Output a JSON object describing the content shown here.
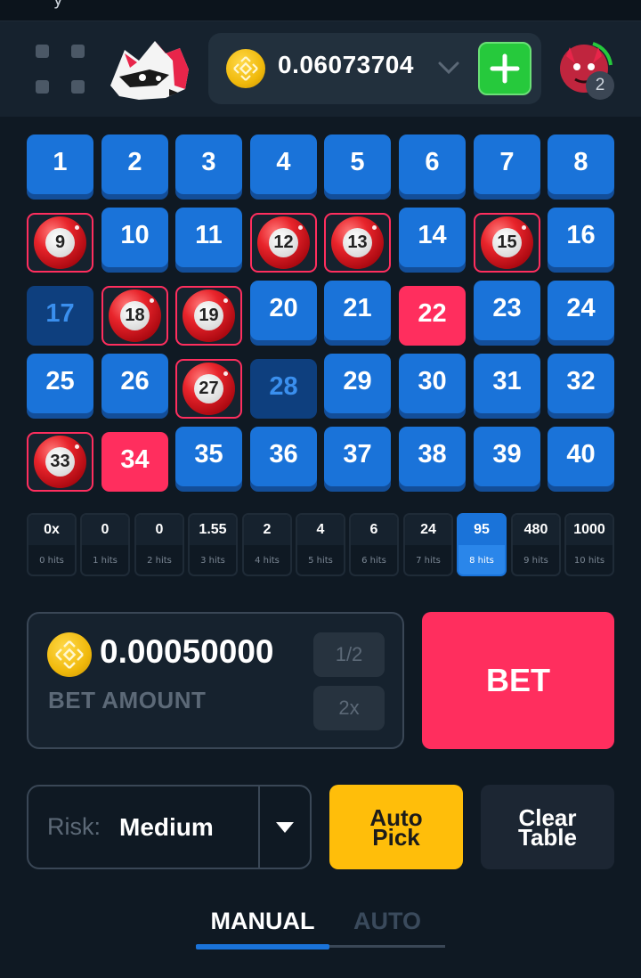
{
  "header": {
    "balance": "0.06073704",
    "notifications_count": "2"
  },
  "tiles": [
    {
      "n": "1",
      "state": "blue"
    },
    {
      "n": "2",
      "state": "blue"
    },
    {
      "n": "3",
      "state": "blue"
    },
    {
      "n": "4",
      "state": "blue"
    },
    {
      "n": "5",
      "state": "blue"
    },
    {
      "n": "6",
      "state": "blue"
    },
    {
      "n": "7",
      "state": "blue"
    },
    {
      "n": "8",
      "state": "blue"
    },
    {
      "n": "9",
      "state": "hit"
    },
    {
      "n": "10",
      "state": "blue"
    },
    {
      "n": "11",
      "state": "blue"
    },
    {
      "n": "12",
      "state": "hit"
    },
    {
      "n": "13",
      "state": "hit"
    },
    {
      "n": "14",
      "state": "blue"
    },
    {
      "n": "15",
      "state": "hit"
    },
    {
      "n": "16",
      "state": "blue"
    },
    {
      "n": "17",
      "state": "dim"
    },
    {
      "n": "18",
      "state": "hit"
    },
    {
      "n": "19",
      "state": "hit"
    },
    {
      "n": "20",
      "state": "blue"
    },
    {
      "n": "21",
      "state": "blue"
    },
    {
      "n": "22",
      "state": "red"
    },
    {
      "n": "23",
      "state": "blue"
    },
    {
      "n": "24",
      "state": "blue"
    },
    {
      "n": "25",
      "state": "blue"
    },
    {
      "n": "26",
      "state": "blue"
    },
    {
      "n": "27",
      "state": "hit"
    },
    {
      "n": "28",
      "state": "dim"
    },
    {
      "n": "29",
      "state": "blue"
    },
    {
      "n": "30",
      "state": "blue"
    },
    {
      "n": "31",
      "state": "blue"
    },
    {
      "n": "32",
      "state": "blue"
    },
    {
      "n": "33",
      "state": "hit"
    },
    {
      "n": "34",
      "state": "red"
    },
    {
      "n": "35",
      "state": "blue"
    },
    {
      "n": "36",
      "state": "blue"
    },
    {
      "n": "37",
      "state": "blue"
    },
    {
      "n": "38",
      "state": "blue"
    },
    {
      "n": "39",
      "state": "blue"
    },
    {
      "n": "40",
      "state": "blue"
    }
  ],
  "payouts": [
    {
      "multiplier": "0x",
      "hits": "0 hits"
    },
    {
      "multiplier": "0",
      "hits": "1 hits"
    },
    {
      "multiplier": "0",
      "hits": "2 hits"
    },
    {
      "multiplier": "1.55",
      "hits": "3 hits"
    },
    {
      "multiplier": "2",
      "hits": "4 hits"
    },
    {
      "multiplier": "4",
      "hits": "5 hits"
    },
    {
      "multiplier": "6",
      "hits": "6 hits"
    },
    {
      "multiplier": "24",
      "hits": "7 hits"
    },
    {
      "multiplier": "95",
      "hits": "8 hits",
      "active": true
    },
    {
      "multiplier": "480",
      "hits": "9 hits"
    },
    {
      "multiplier": "1000",
      "hits": "10 hits"
    }
  ],
  "bet": {
    "amount": "0.00050000",
    "label": "BET AMOUNT",
    "half_label": "1/2",
    "double_label": "2x",
    "button_label": "BET"
  },
  "risk": {
    "label": "Risk:",
    "value": "Medium"
  },
  "actions": {
    "auto_pick_line1": "Auto",
    "auto_pick_line2": "Pick",
    "clear_table_line1": "Clear",
    "clear_table_line2": "Table"
  },
  "tabs": {
    "manual": "MANUAL",
    "auto": "AUTO"
  },
  "colors": {
    "background": "#0f1923",
    "tile_blue": "#1a73d9",
    "accent_red": "#ff2e5e",
    "accent_green": "#26c93c",
    "accent_yellow": "#ffbe0a",
    "coin_gold": "#f0b90b"
  },
  "icons": {
    "menu": "menu-grid-icon",
    "logo": "raccoon-logo",
    "coin": "bnb-coin-icon",
    "chevron": "chevron-down-icon",
    "add": "plus-icon",
    "avatar": "user-avatar",
    "risk_arrow": "caret-down-icon"
  }
}
